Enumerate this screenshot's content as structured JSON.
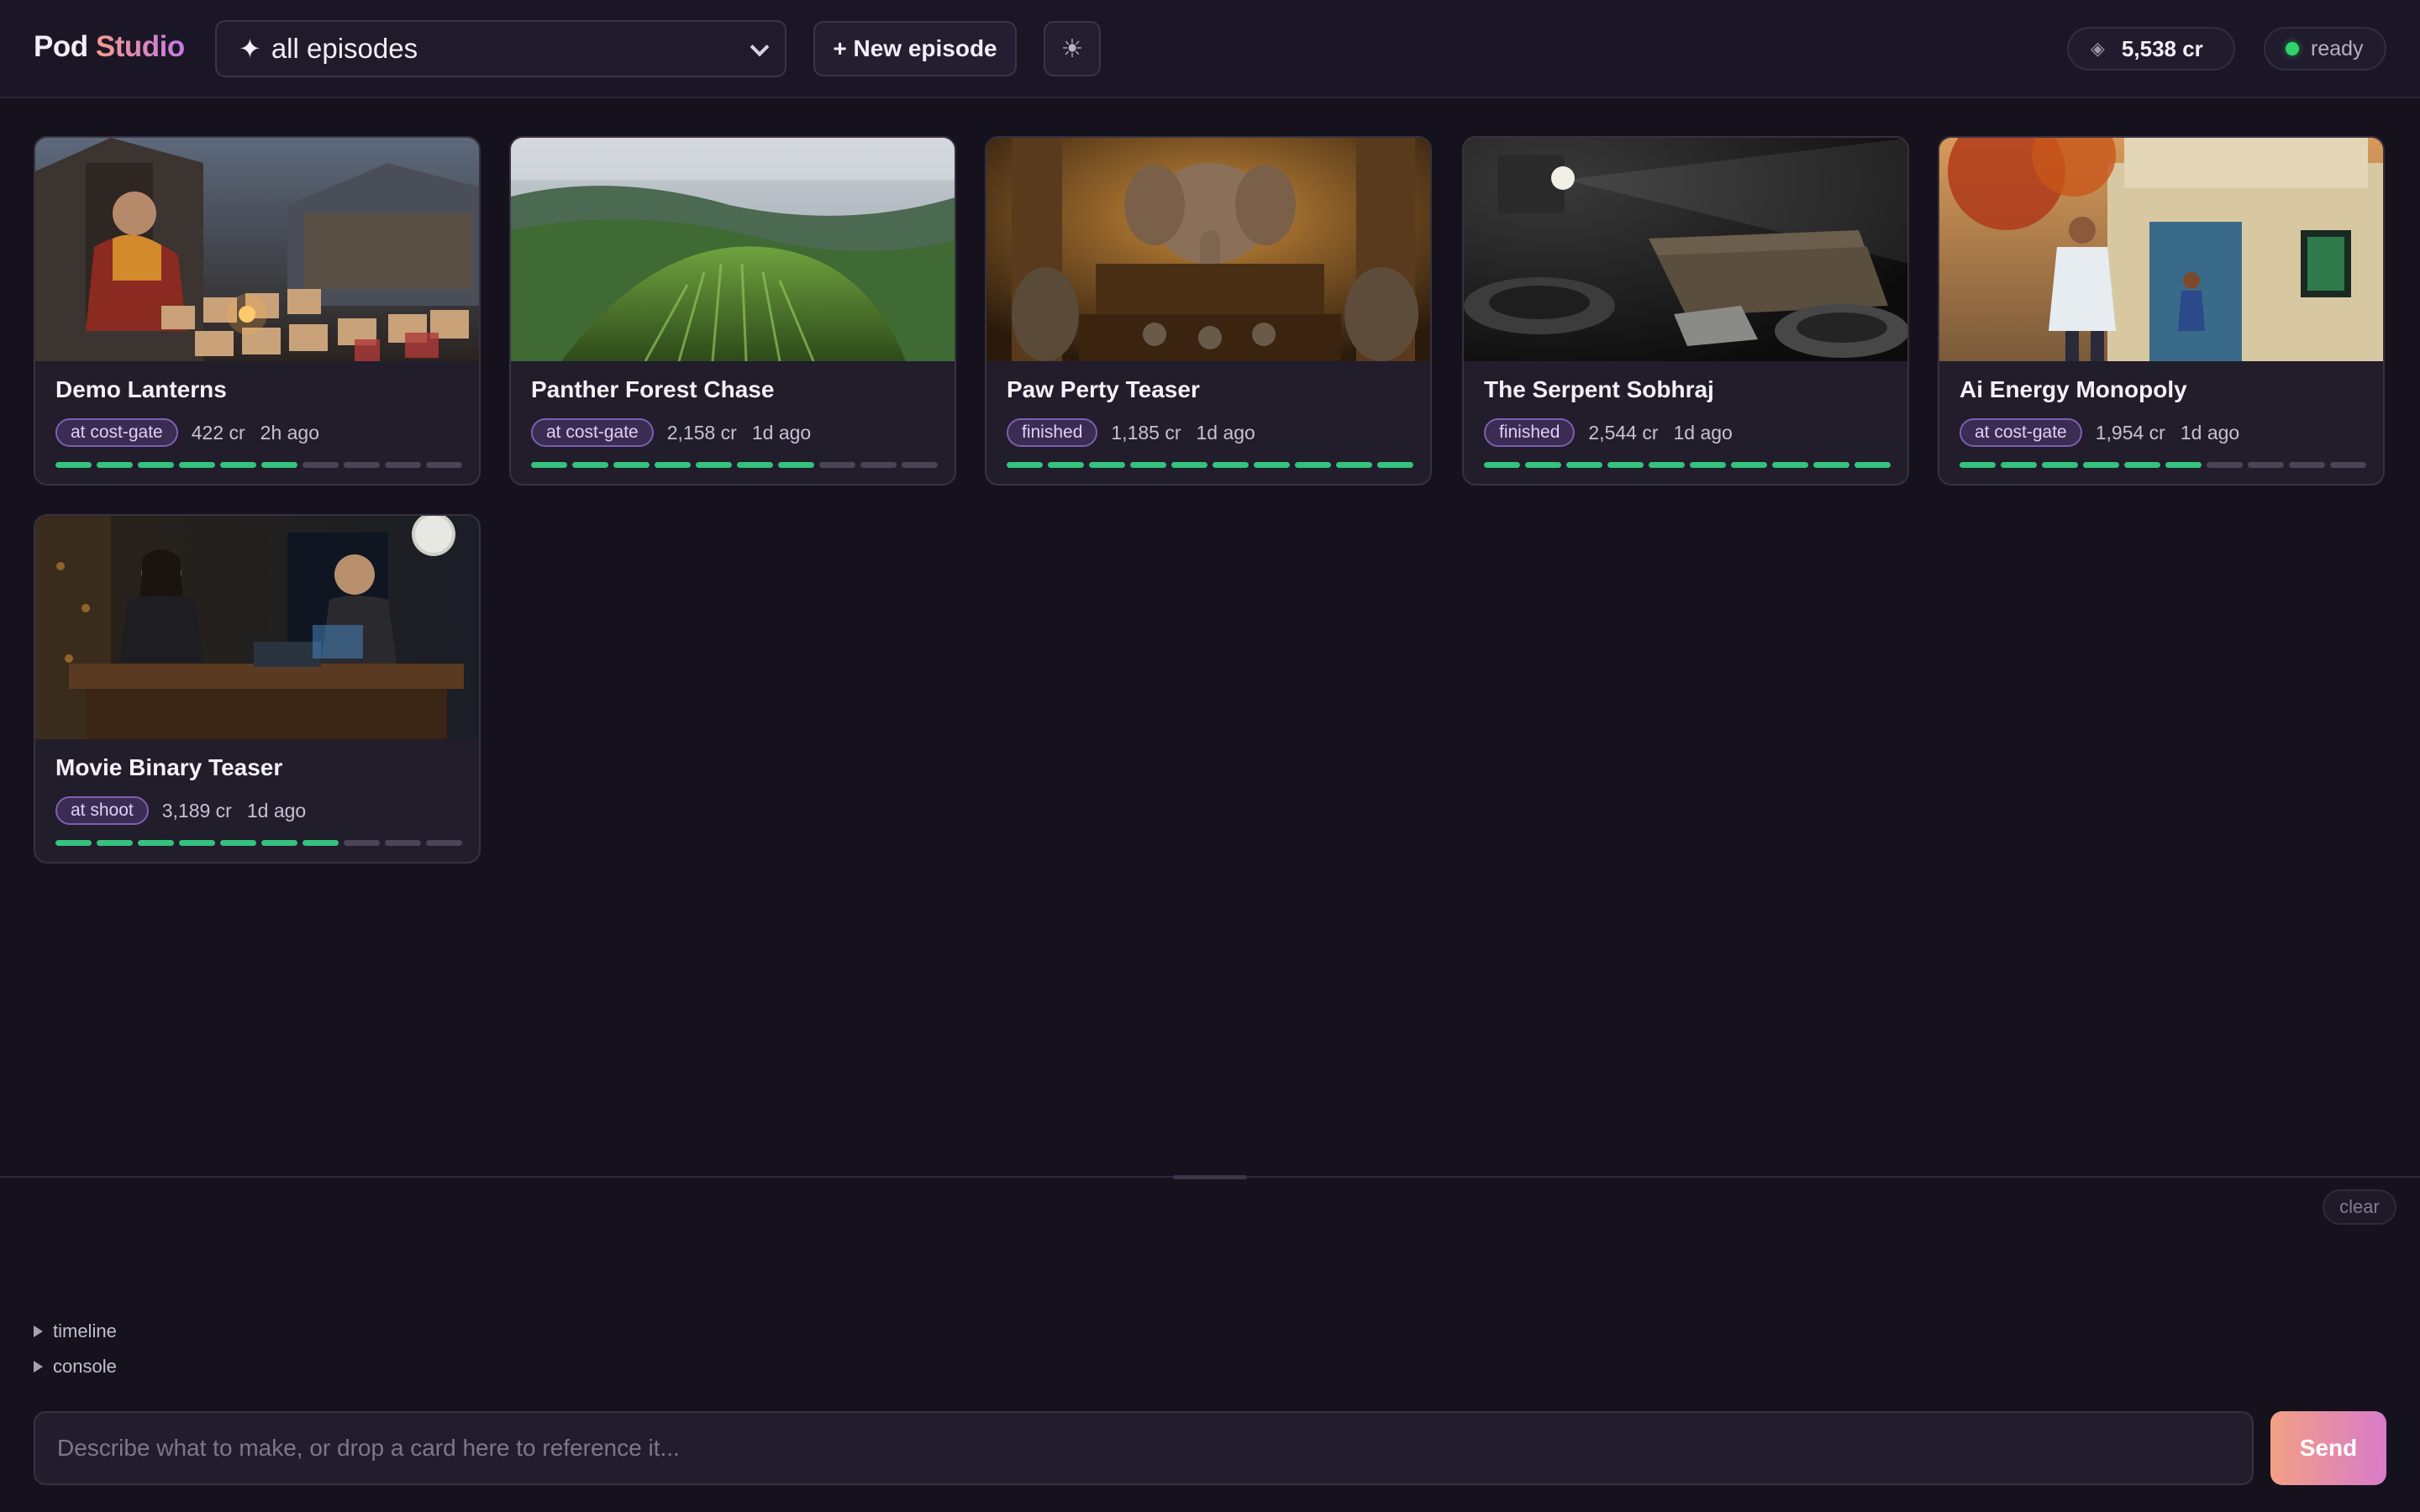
{
  "header": {
    "brand_part1": "Pod",
    "brand_part2": "Studio",
    "episode_select": {
      "icon": "sparkle-icon",
      "value": "all episodes"
    },
    "new_episode_label": "+ New episode",
    "theme_icon": "sun-icon",
    "credits": "5,538 cr",
    "status": "ready"
  },
  "cards": [
    {
      "title": "Demo Lanterns",
      "status": "at cost-gate",
      "credits": "422 cr",
      "ago": "2h ago",
      "progress": 0.6,
      "thumb": "monk-lanterns"
    },
    {
      "title": "Panther Forest Chase",
      "status": "at cost-gate",
      "credits": "2,158 cr",
      "ago": "1d ago",
      "progress": 0.7,
      "thumb": "grass-hills"
    },
    {
      "title": "Paw Perty Teaser",
      "status": "finished",
      "credits": "1,185 cr",
      "ago": "1d ago",
      "progress": 1.0,
      "thumb": "elephant-court"
    },
    {
      "title": "The Serpent Sobhraj",
      "status": "finished",
      "credits": "2,544 cr",
      "ago": "1d ago",
      "progress": 1.0,
      "thumb": "film-reels"
    },
    {
      "title": "Ai Energy Monopoly",
      "status": "at cost-gate",
      "credits": "1,954 cr",
      "ago": "1d ago",
      "progress": 0.6,
      "thumb": "school"
    },
    {
      "title": "Movie Binary Teaser",
      "status": "at shoot",
      "credits": "3,189 cr",
      "ago": "1d ago",
      "progress": 0.7,
      "thumb": "office-night"
    }
  ],
  "panel": {
    "clear_label": "clear",
    "timeline_label": "timeline",
    "console_label": "console",
    "input_placeholder": "Describe what to make, or drop a card here to reference it...",
    "send_label": "Send"
  },
  "colors": {
    "accent": "#34c27c",
    "badge_border": "#7d5fb0",
    "status_ready": "#2fd36c"
  }
}
